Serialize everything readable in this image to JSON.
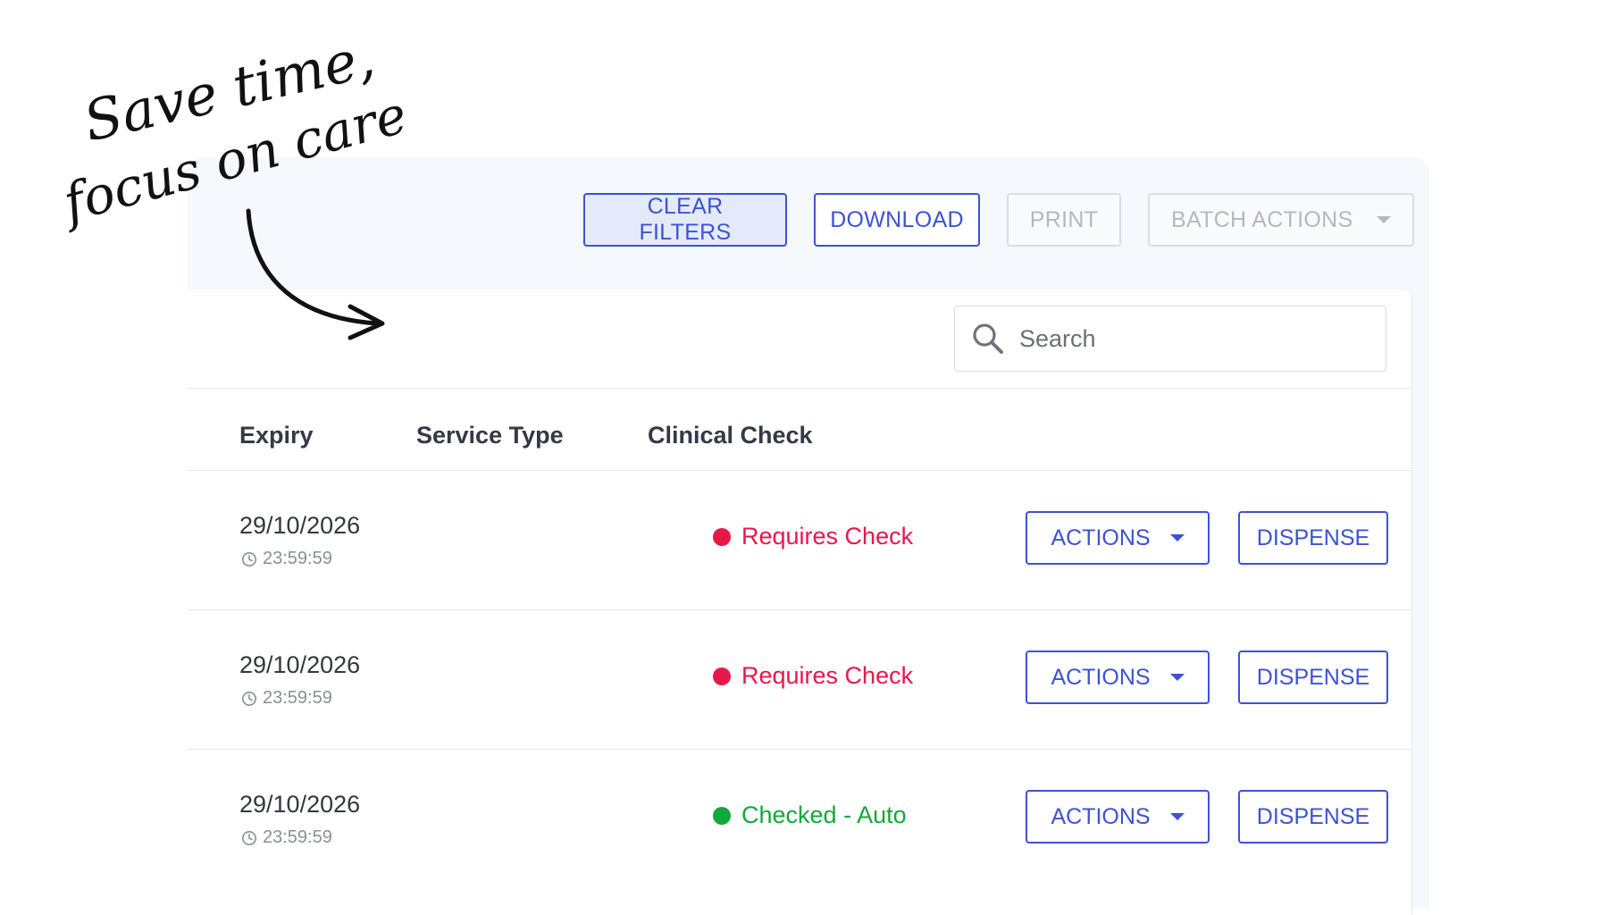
{
  "annotation": {
    "line1": "Save time,",
    "line2": "focus on care"
  },
  "toolbar": {
    "clear_filters_label": "CLEAR FILTERS",
    "download_label": "DOWNLOAD",
    "print_label": "PRINT",
    "batch_actions_label": "BATCH ACTIONS"
  },
  "search": {
    "placeholder": "Search",
    "icon": "search-icon"
  },
  "table": {
    "columns": [
      "Expiry",
      "Service Type",
      "Clinical Check"
    ],
    "rows": [
      {
        "expiry_date": "29/10/2026",
        "expiry_time": "23:59:59",
        "service_type": "",
        "clinical_check": "Requires Check",
        "actions_label": "ACTIONS",
        "dispense_label": "DISPENSE"
      },
      {
        "expiry_date": "29/10/2026",
        "expiry_time": "23:59:59",
        "service_type": "",
        "clinical_check": "Requires Check",
        "actions_label": "ACTIONS",
        "dispense_label": "DISPENSE"
      },
      {
        "expiry_date": "29/10/2026",
        "expiry_time": "23:59:59",
        "service_type": "",
        "clinical_check": "Checked - Auto",
        "actions_label": "ACTIONS",
        "dispense_label": "DISPENSE"
      }
    ]
  },
  "colors": {
    "accent": "#3d52d5",
    "requires_check": "#e8174a",
    "checked_auto": "#12a83a",
    "panel_bg": "#f5f8fc"
  }
}
